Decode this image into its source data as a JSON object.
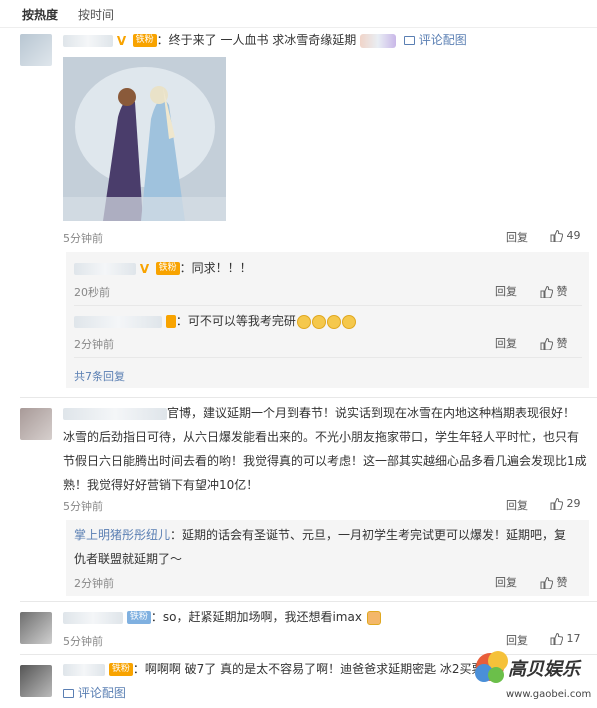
{
  "tabs": {
    "hot": "按热度",
    "time": "按时间"
  },
  "comments": [
    {
      "text_a": "：终于来了 一人血书 求冰雪奇缘延期",
      "pic_label": "评论配图",
      "time": "5分钟前",
      "reply": "回复",
      "likes": "49",
      "fan_badge": "铁粉",
      "replies": [
        {
          "text": "：同求！！！",
          "time": "20秒前",
          "reply": "回复",
          "likes": "赞",
          "fan_badge": "铁粉"
        },
        {
          "text": "：可不可以等我考完研",
          "time": "2分钟前",
          "reply": "回复",
          "likes": "赞"
        }
      ],
      "more": "共7条回复"
    },
    {
      "line1": "官博，建议延期一个月到春节！说实话到现在冰雪在内地这种档期表现很好！",
      "line2": "冰雪的后劲指日可待，从六日爆发能看出来的。不光小朋友拖家带口，学生年轻人平时忙，也只有",
      "line3": "节假日六日能腾出时间去看的哟！我觉得真的可以考虑！这一部其实越细心品多看几遍会发现比1成",
      "line4": "熟！我觉得好好营销下有望冲10亿！",
      "time": "5分钟前",
      "reply": "回复",
      "likes": "29",
      "replies": [
        {
          "name": "掌上明猪彤彤纽儿",
          "text_a": "：延期的话会有圣诞节、元旦，一月初学生考完试更可以爆发！延期吧，复",
          "text_b": "仇者联盟就延期了～",
          "time": "2分钟前",
          "reply": "回复",
          "likes": "赞"
        }
      ]
    },
    {
      "text": "：so，赶紧延期加场啊，我还想看imax",
      "time": "5分钟前",
      "reply": "回复",
      "likes": "17",
      "fan_badge": "铁粉"
    },
    {
      "text": "：啊啊啊 破7了   真的是太不容易了啊！迪爸爸求延期密匙  冰2买票",
      "pic_label": "评论配图",
      "fan_badge": "铁粉"
    }
  ],
  "watermark": {
    "brand": "高贝娱乐",
    "url": "www.gaobei.com"
  }
}
